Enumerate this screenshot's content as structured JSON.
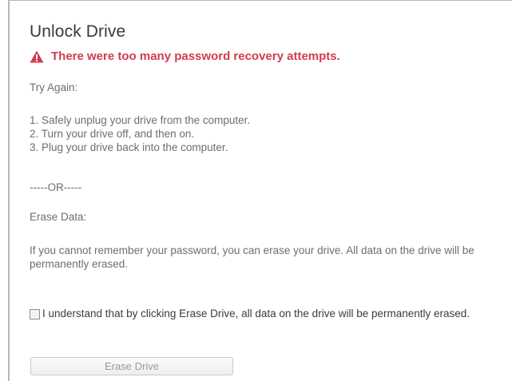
{
  "dialog": {
    "title": "Unlock Drive",
    "alert": {
      "icon": "warning-triangle-icon",
      "text": "There were too many password recovery attempts.",
      "color": "#d33c4c"
    },
    "try_again_label": "Try Again:",
    "steps": [
      "1. Safely unplug your drive from the computer.",
      "2. Turn your drive off, and then on.",
      "3. Plug your drive back into the computer."
    ],
    "separator": "-----OR-----",
    "erase_label": "Erase Data:",
    "erase_description": "If you cannot remember your password, you can erase your drive. All data on the drive will be permanently erased.",
    "checkbox": {
      "checked": false,
      "label": "I understand that by clicking Erase Drive, all data on the drive will be permanently erased."
    },
    "erase_button_label": "Erase Drive"
  }
}
